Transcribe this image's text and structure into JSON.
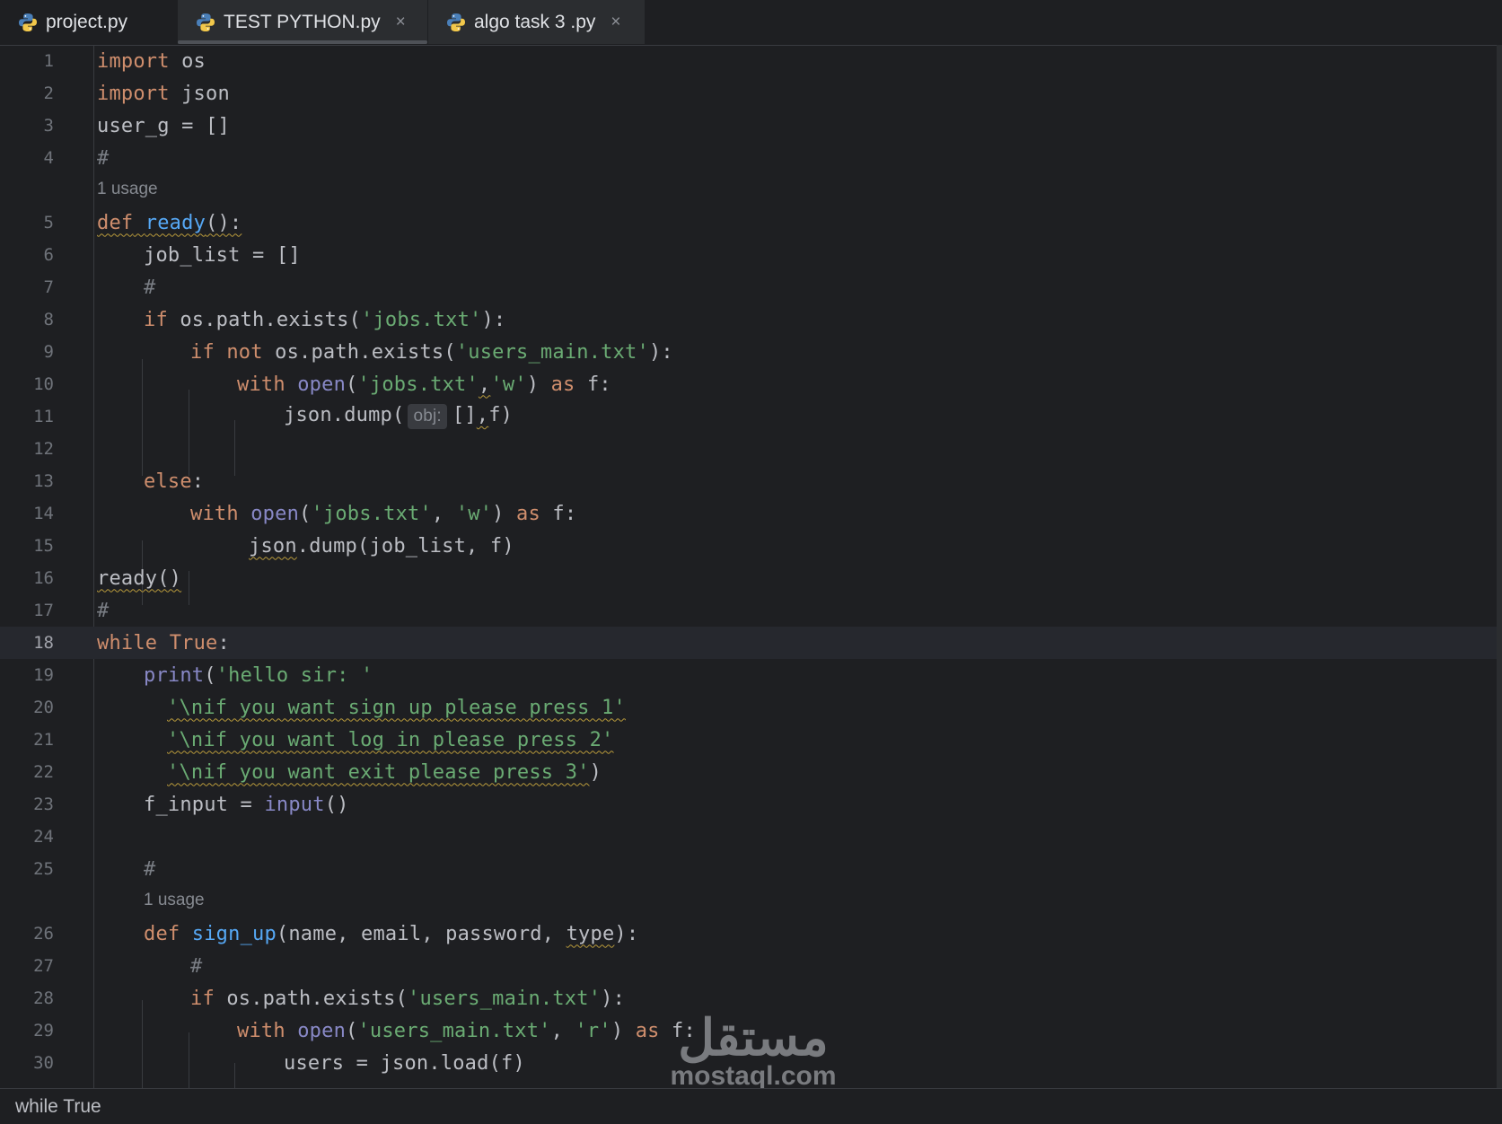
{
  "tabs": [
    {
      "label": "project.py",
      "icon": "python-icon",
      "closable": false
    },
    {
      "label": "TEST PYTHON.py",
      "icon": "python-icon",
      "closable": true,
      "active": true
    },
    {
      "label": "algo task 3 .py",
      "icon": "python-icon",
      "closable": true
    }
  ],
  "tab_close_glyph": "×",
  "editor": {
    "current_line": 18,
    "lines": [
      {
        "n": "1"
      },
      {
        "n": "2"
      },
      {
        "n": "3"
      },
      {
        "n": "4"
      },
      {
        "n": "5"
      },
      {
        "n": "6"
      },
      {
        "n": "7"
      },
      {
        "n": "8"
      },
      {
        "n": "9"
      },
      {
        "n": "10"
      },
      {
        "n": "11"
      },
      {
        "n": "12"
      },
      {
        "n": "13"
      },
      {
        "n": "14"
      },
      {
        "n": "15"
      },
      {
        "n": "16"
      },
      {
        "n": "17"
      },
      {
        "n": "18"
      },
      {
        "n": "19"
      },
      {
        "n": "20"
      },
      {
        "n": "21"
      },
      {
        "n": "22"
      },
      {
        "n": "23"
      },
      {
        "n": "24"
      },
      {
        "n": "25"
      },
      {
        "n": "26"
      },
      {
        "n": "27"
      },
      {
        "n": "28"
      },
      {
        "n": "29"
      },
      {
        "n": "30"
      }
    ],
    "code": {
      "l1": [
        "import",
        " os"
      ],
      "l2": [
        "import",
        " json"
      ],
      "l3": [
        "user_g = []"
      ],
      "l4": [
        "#"
      ],
      "usage1": "1 usage",
      "l5": [
        "def",
        " ",
        "ready",
        "():"
      ],
      "l6": [
        "job_list = []"
      ],
      "l7": [
        "#"
      ],
      "l8": [
        "if",
        " os.path.exists(",
        "'jobs.txt'",
        "):"
      ],
      "l9": [
        "if",
        " ",
        "not",
        " os.path.exists(",
        "'users_main.txt'",
        "):"
      ],
      "l10": [
        "with",
        " ",
        "open",
        "(",
        "'jobs.txt'",
        ",",
        "'w'",
        ") ",
        "as",
        " f:"
      ],
      "l11": [
        "json.dump(",
        "obj:",
        "[]",
        ",",
        "f)"
      ],
      "l13": [
        "else",
        ":"
      ],
      "l14": [
        "with",
        " ",
        "open",
        "(",
        "'jobs.txt'",
        ", ",
        "'w'",
        ") ",
        "as",
        " f:"
      ],
      "l15": [
        "json",
        ".dump(job_list, f)"
      ],
      "l16": [
        "ready()"
      ],
      "l17": [
        "#"
      ],
      "l18": [
        "while",
        " ",
        "True",
        ":"
      ],
      "l19": [
        "print",
        "(",
        "'hello sir: '"
      ],
      "l20": [
        "'\\nif you want sign up please press 1'"
      ],
      "l21": [
        "'\\nif you want log in please press 2'"
      ],
      "l22": [
        "'\\nif you want exit please press 3'",
        ")"
      ],
      "l23": [
        "f_input = ",
        "input",
        "()"
      ],
      "l25": [
        "#"
      ],
      "usage2": "1 usage",
      "l26": [
        "def",
        " ",
        "sign_up",
        "(name, email, password, ",
        "type",
        "):"
      ],
      "l27": [
        "#"
      ],
      "l28": [
        "if",
        " os.path.exists(",
        "'users_main.txt'",
        "):"
      ],
      "l29": [
        "with",
        " ",
        "open",
        "(",
        "'users_main.txt'",
        ", ",
        "'r'",
        ") ",
        "as",
        " f:"
      ],
      "l30": [
        "users = json.load(f)"
      ]
    }
  },
  "statusbar": {
    "breadcrumb": "while True"
  },
  "watermark": {
    "arabic": "مستقل",
    "latin": "mostaql.com"
  },
  "colors": {
    "background": "#1e1f22",
    "keyword": "#cf8e6d",
    "function": "#56a8f5",
    "builtin": "#8888c6",
    "string": "#6aab73",
    "text": "#bcbec4"
  }
}
